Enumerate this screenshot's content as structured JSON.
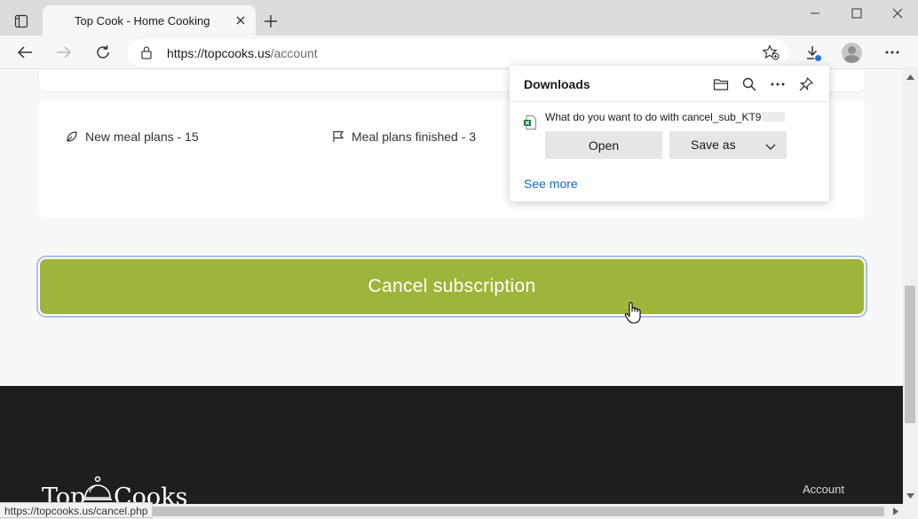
{
  "browser": {
    "tab_title": "Top Cook - Home Cooking",
    "url_host": "https://topcooks.us",
    "url_path": "/account",
    "status_url": "https://topcooks.us/cancel.php"
  },
  "stats": {
    "new_meal_plans": "New meal plans - 15",
    "meal_plans_finished": "Meal plans finished - 3"
  },
  "cancel_button_label": "Cancel subscription",
  "downloads": {
    "title": "Downloads",
    "question": "What do you want to do with cancel_sub_KT9",
    "open_label": "Open",
    "save_as_label": "Save as",
    "see_more_label": "See more"
  },
  "footer": {
    "logo_left": "Top",
    "logo_right": "Cooks",
    "account_link": "Account"
  },
  "colors": {
    "accent_green": "#9db53a",
    "footer_bg": "#1e1e1e",
    "link_blue": "#1467c3"
  },
  "icons": {
    "tab_actions": "tab-actions-icon",
    "back": "back-arrow-icon",
    "forward": "forward-arrow-icon",
    "refresh": "refresh-icon",
    "lock": "lock-icon",
    "favorites": "add-favorite-star-icon",
    "downloads": "download-icon",
    "menu": "more-horizontal-icon",
    "folder": "open-folder-icon",
    "search": "search-icon",
    "pin": "pin-icon",
    "excel_file": "excel-file-icon"
  }
}
